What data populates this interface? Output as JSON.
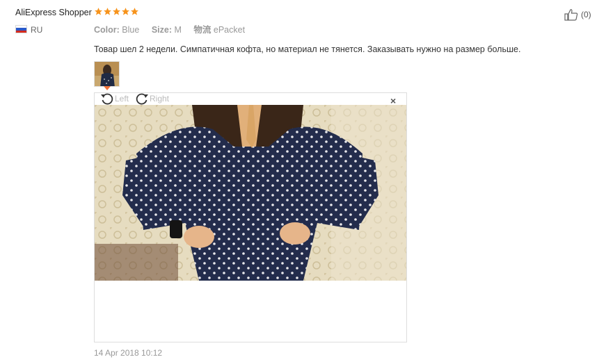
{
  "buyer": {
    "name": "AliExpress Shopper",
    "country": "RU",
    "rating_stars": 5,
    "star_color": "#f7941d"
  },
  "attributes": [
    {
      "key": "Color:",
      "value": "Blue"
    },
    {
      "key": "Size:",
      "value": "M"
    },
    {
      "key": "物流",
      "value": "ePacket"
    }
  ],
  "helpful": {
    "count_label": "(0)",
    "icon": "thumbs-up-icon"
  },
  "review": {
    "text": "Товар шел 2 недели. Симпатичная кофта, но материал не тянется. Заказывать нужно на размер больше."
  },
  "viewer": {
    "rotate_left_label": "Left",
    "rotate_right_label": "Right",
    "close_label": "×",
    "accent": "#f1743c"
  },
  "date": "14 Apr 2018 10:12"
}
